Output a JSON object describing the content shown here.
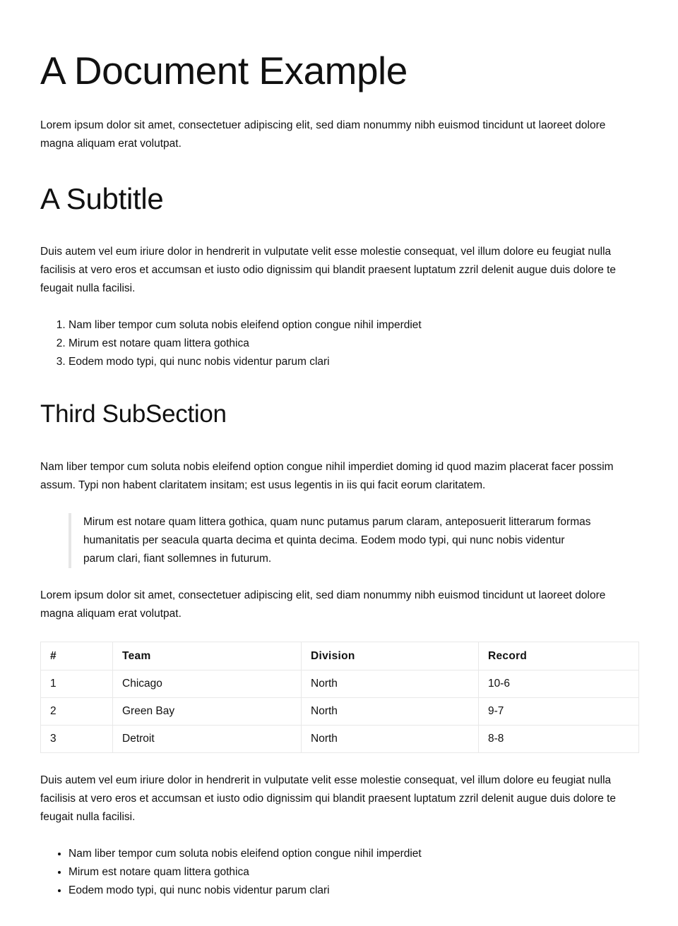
{
  "title": "A Document Example",
  "intro": "Lorem ipsum dolor sit amet, consectetuer adipiscing elit, sed diam nonummy nibh euismod tincidunt ut laoreet dolore magna aliquam erat volutpat.",
  "subtitle": "A Subtitle",
  "subtitle_paragraph": "Duis autem vel eum iriure dolor in hendrerit in vulputate velit esse molestie consequat, vel illum dolore eu feugiat nulla facilisis at vero eros et accumsan et iusto odio dignissim qui blandit praesent luptatum zzril delenit augue duis dolore te feugait nulla facilisi.",
  "ordered_list": [
    "Nam liber tempor cum soluta nobis eleifend option congue nihil imperdiet",
    "Mirum est notare quam littera gothica",
    "Eodem modo typi, qui nunc nobis videntur parum clari"
  ],
  "third_heading": "Third SubSection",
  "third_paragraph": "Nam liber tempor cum soluta nobis eleifend option congue nihil imperdiet doming id quod mazim placerat facer possim assum. Typi non habent claritatem insitam; est usus legentis in iis qui facit eorum claritatem.",
  "blockquote": "Mirum est notare quam littera gothica, quam nunc putamus parum claram, anteposuerit litterarum formas humanitatis per seacula quarta decima et quinta decima. Eodem modo typi, qui nunc nobis videntur parum clari, fiant sollemnes in futurum.",
  "after_quote_paragraph": "Lorem ipsum dolor sit amet, consectetuer adipiscing elit, sed diam nonummy nibh euismod tincidunt ut laoreet dolore magna aliquam erat volutpat.",
  "table": {
    "headers": [
      "#",
      "Team",
      "Division",
      "Record"
    ],
    "rows": [
      [
        "1",
        "Chicago",
        "North",
        "10-6"
      ],
      [
        "2",
        "Green Bay",
        "North",
        "9-7"
      ],
      [
        "3",
        "Detroit",
        "North",
        "8-8"
      ]
    ]
  },
  "closing_paragraph": "Duis autem vel eum iriure dolor in hendrerit in vulputate velit esse molestie consequat, vel illum dolore eu feugiat nulla facilisis at vero eros et accumsan et iusto odio dignissim qui blandit praesent luptatum zzril delenit augue duis dolore te feugait nulla facilisi.",
  "bullet_list": [
    "Nam liber tempor cum soluta nobis eleifend option congue nihil imperdiet",
    "Mirum est notare quam littera gothica",
    "Eodem modo typi, qui nunc nobis videntur parum clari"
  ]
}
